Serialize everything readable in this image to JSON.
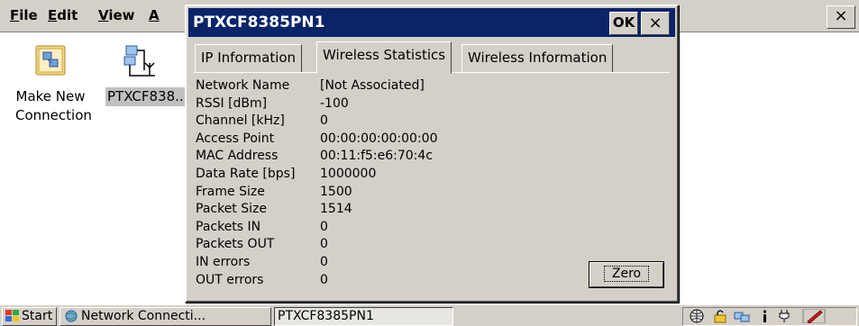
{
  "menubar": {
    "file": "File",
    "edit": "Edit",
    "view": "View",
    "advanced": "A"
  },
  "desktop": {
    "items": [
      {
        "label_line1": "Make New",
        "label_line2": "Connection",
        "icon": "new-connection-icon"
      },
      {
        "label": "PTXCF838..",
        "icon": "network-connection-icon"
      }
    ]
  },
  "dialog": {
    "title": "PTXCF8385PN1",
    "ok_label": "OK",
    "close_label": "×",
    "tabs": [
      {
        "label": "IP Information"
      },
      {
        "label": "Wireless Statistics"
      },
      {
        "label": "Wireless Information"
      }
    ],
    "stats": [
      {
        "label": "Network Name",
        "value": "[Not Associated]"
      },
      {
        "label": "RSSI [dBm]",
        "value": "-100"
      },
      {
        "label": "Channel [kHz]",
        "value": "0"
      },
      {
        "label": "Access Point",
        "value": "00:00:00:00:00:00"
      },
      {
        "label": "MAC Address",
        "value": "00:11:f5:e6:70:4c"
      },
      {
        "label": "Data Rate [bps]",
        "value": "1000000"
      },
      {
        "label": "Frame Size",
        "value": "1500"
      },
      {
        "label": "Packet Size",
        "value": "1514"
      },
      {
        "label": "Packets IN",
        "value": "0"
      },
      {
        "label": "Packets OUT",
        "value": "0"
      },
      {
        "label": "IN errors",
        "value": "0"
      },
      {
        "label": "OUT errors",
        "value": "0"
      }
    ],
    "zero_label": "Zero"
  },
  "window_close_label": "×",
  "taskbar": {
    "start_label": "Start",
    "network_label": "Network Connecti...",
    "dialog_label": "PTXCF8385PN1",
    "tray_icons": [
      "globe-icon",
      "lock-icon",
      "network-tray-icon",
      "info-icon",
      "power-plug-icon",
      "pen-icon"
    ]
  },
  "colors": {
    "titlebar": "#0a246a",
    "face": "#d4d0c8"
  }
}
